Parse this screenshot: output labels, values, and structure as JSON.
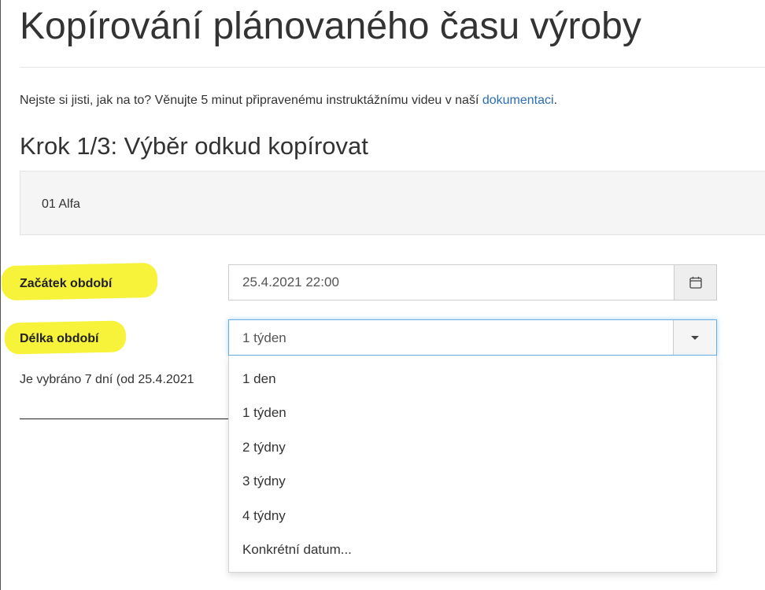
{
  "header": {
    "title": "Kopírování plánovaného času výroby"
  },
  "intro": {
    "text_before": "Nejste si jisti, jak na to? Věnujte 5 minut připravenému instruktážnímu videu v naší ",
    "link_text": "dokumentaci",
    "text_after": "."
  },
  "step": {
    "heading": "Krok 1/3: Výběr odkud kopírovat",
    "selected_item": "01 Alfa"
  },
  "form": {
    "start": {
      "label": "Začátek období",
      "value": "25.4.2021 22:00",
      "button_icon": "calendar-icon"
    },
    "length": {
      "label": "Délka období",
      "selected": "1 týden",
      "button_icon": "caret-down-icon",
      "options": [
        "1 den",
        "1 týden",
        "2 týdny",
        "3 týdny",
        "4 týdny",
        "Konkrétní datum..."
      ]
    },
    "info_text": "Je vybráno 7 dní (od 25.4.2021"
  },
  "colors": {
    "highlight": "#f6f33a",
    "link": "#2a6db3",
    "focus_border": "#66afe9"
  }
}
